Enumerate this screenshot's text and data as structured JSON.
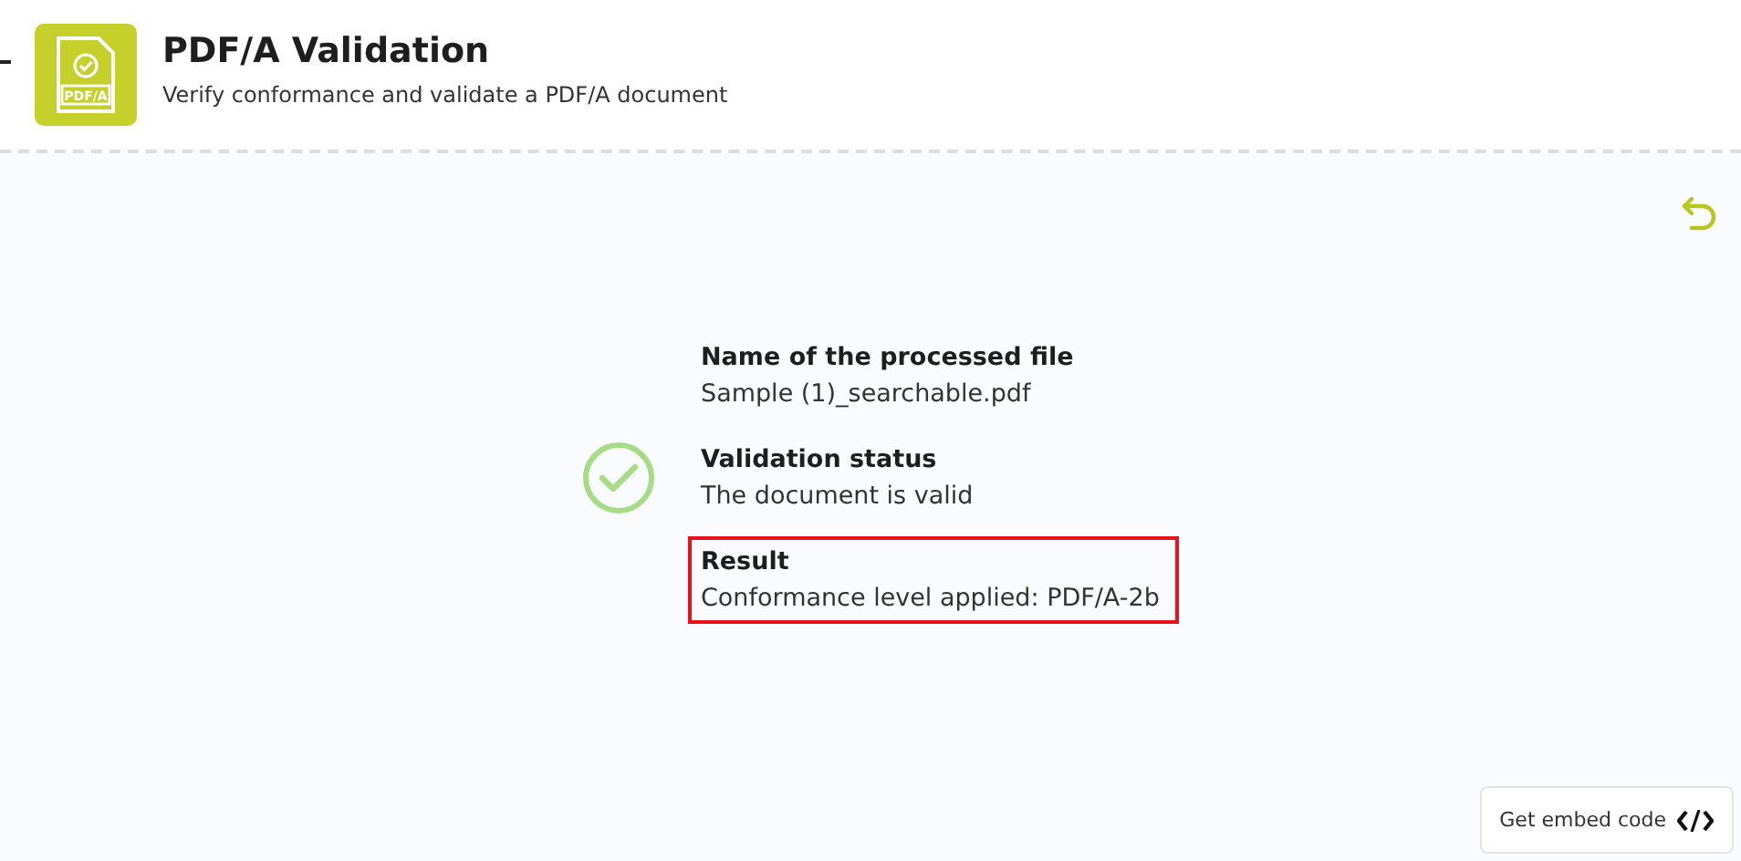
{
  "header": {
    "logo_label": "PDF/A",
    "title": "PDF/A Validation",
    "subtitle": "Verify conformance and validate a PDF/A document"
  },
  "result": {
    "valid": true,
    "fields": [
      {
        "label": "Name of the processed file",
        "value": "Sample (1)_searchable.pdf",
        "highlighted": false
      },
      {
        "label": "Validation status",
        "value": "The document is valid",
        "highlighted": false
      },
      {
        "label": "Result",
        "value": "Conformance level applied: PDF/A-2b",
        "highlighted": true
      }
    ]
  },
  "embed_button": {
    "label": "Get embed code"
  }
}
